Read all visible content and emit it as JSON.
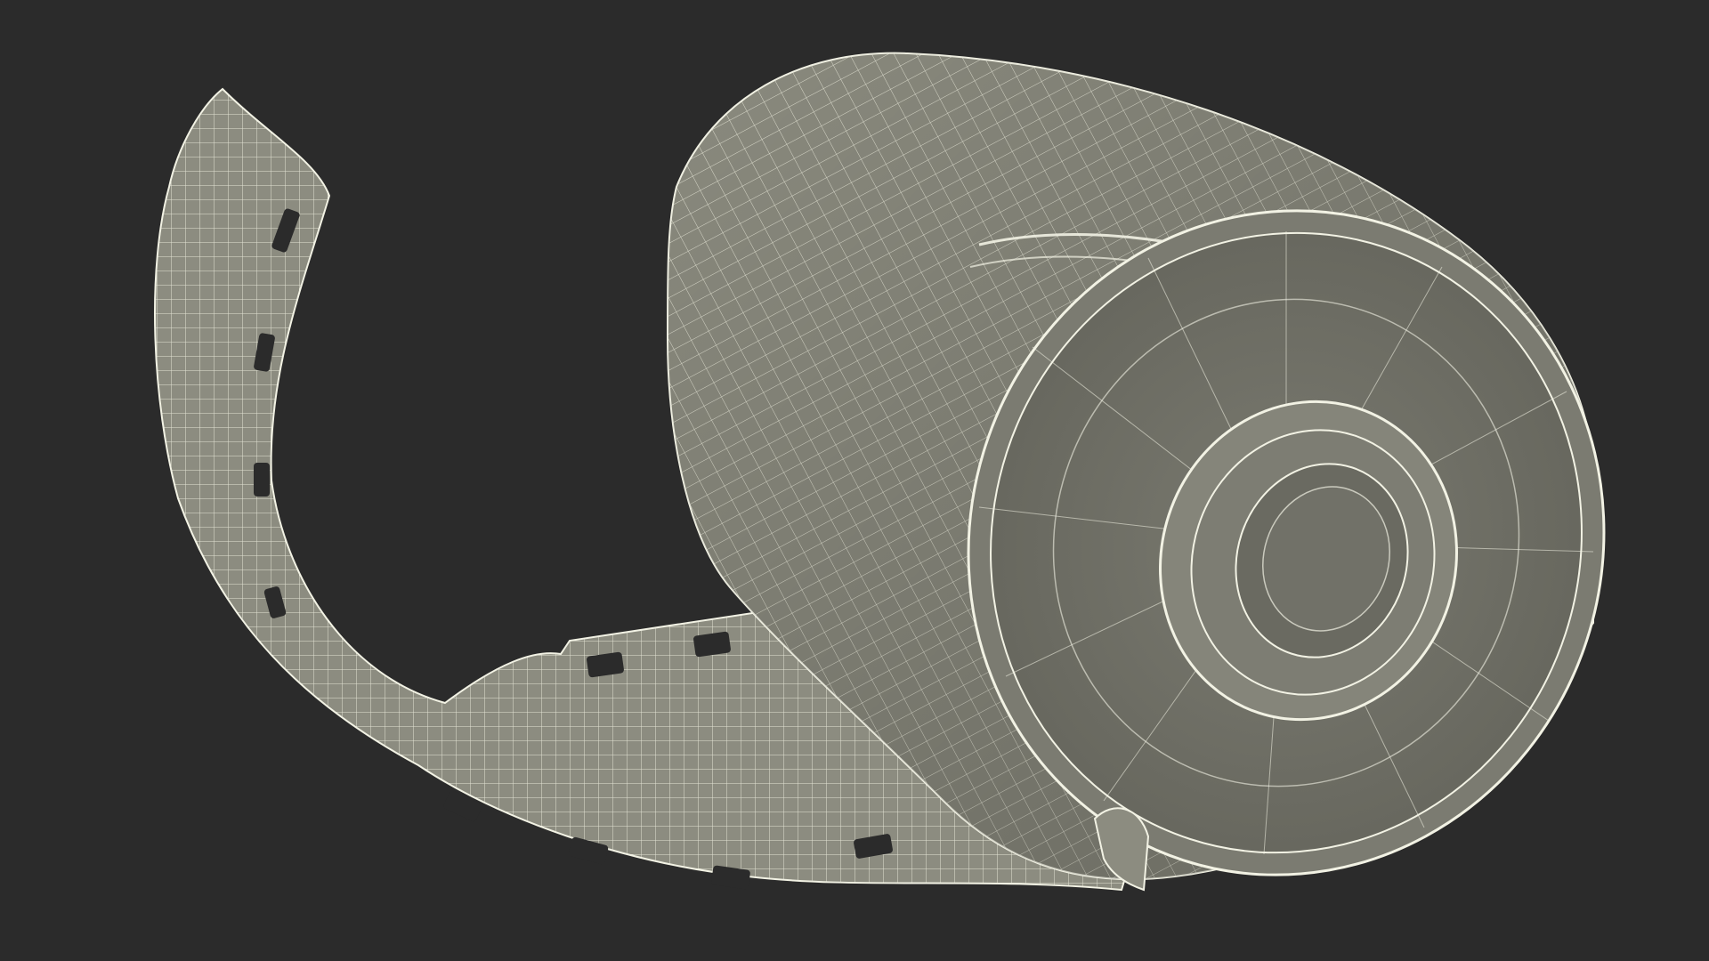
{
  "scene": {
    "subject": "film-canister-wireframe-icon",
    "colors": {
      "background": "#2b2b2b",
      "surface": "#8a8a7e",
      "surface_dark": "#6e6e64",
      "surface_light": "#9d9d91",
      "wire": "#f2f2e4"
    }
  }
}
